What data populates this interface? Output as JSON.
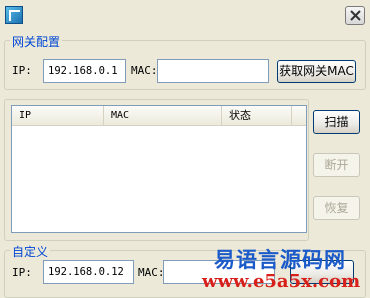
{
  "gateway_group": {
    "title": "网关配置",
    "ip_label": "IP:",
    "ip_value": "192.168.0.1",
    "mac_label": "MAC:",
    "mac_value": "",
    "get_mac_button": "获取网关MAC"
  },
  "list": {
    "columns": [
      "IP",
      "MAC",
      "状态"
    ],
    "rows": []
  },
  "side_buttons": {
    "scan": "扫描",
    "disconnect": "断开",
    "restore": "恢复"
  },
  "custom_group": {
    "title": "自定义",
    "ip_label": "IP:",
    "ip_value": "192.168.0.12",
    "mac_label": "MAC:",
    "mac_value": ""
  },
  "watermark": {
    "line1": "易语言源码网",
    "line2": "www.e5a5x.com"
  }
}
